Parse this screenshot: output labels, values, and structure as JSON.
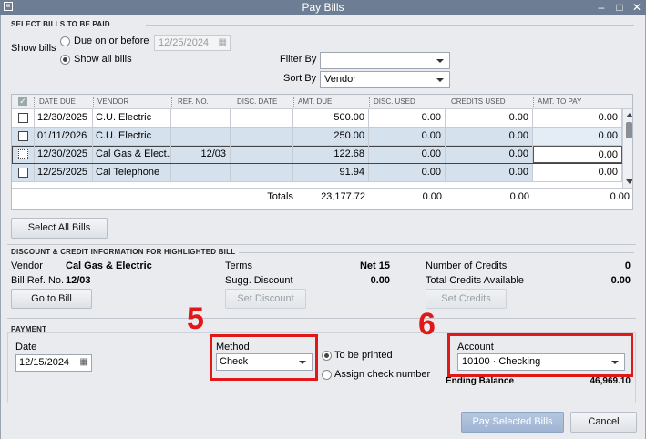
{
  "window": {
    "title": "Pay Bills"
  },
  "select_bills": {
    "section_title": "SELECT BILLS TO BE PAID",
    "show_bills_label": "Show bills",
    "due_on_or_before_label": "Due on or before",
    "due_date_value": "12/25/2024",
    "show_all_label": "Show all bills",
    "filter_by_label": "Filter By",
    "filter_by_value": "",
    "sort_by_label": "Sort By",
    "sort_by_value": "Vendor"
  },
  "table": {
    "columns": [
      "DATE DUE",
      "VENDOR",
      "REF. NO.",
      "DISC. DATE",
      "AMT. DUE",
      "DISC. USED",
      "CREDITS USED",
      "AMT. TO PAY"
    ],
    "rows": [
      {
        "date_due": "12/30/2025",
        "vendor": "C.U. Electric",
        "ref_no": "",
        "disc_date": "",
        "amt_due": "500.00",
        "disc_used": "0.00",
        "credits_used": "0.00",
        "amt_to_pay": "0.00"
      },
      {
        "date_due": "01/11/2026",
        "vendor": "C.U. Electric",
        "ref_no": "",
        "disc_date": "",
        "amt_due": "250.00",
        "disc_used": "0.00",
        "credits_used": "0.00",
        "amt_to_pay": "0.00"
      },
      {
        "date_due": "12/30/2025",
        "vendor": "Cal Gas & Elect...",
        "ref_no": "12/03",
        "disc_date": "",
        "amt_due": "122.68",
        "disc_used": "0.00",
        "credits_used": "0.00",
        "amt_to_pay": "0.00"
      },
      {
        "date_due": "12/25/2025",
        "vendor": "Cal Telephone",
        "ref_no": "",
        "disc_date": "",
        "amt_due": "91.94",
        "disc_used": "0.00",
        "credits_used": "0.00",
        "amt_to_pay": "0.00"
      }
    ],
    "totals": {
      "label": "Totals",
      "amt_due": "23,177.72",
      "disc_used": "0.00",
      "credits_used": "0.00",
      "amt_to_pay": "0.00"
    }
  },
  "select_all_label": "Select All Bills",
  "discount": {
    "section_title": "DISCOUNT & CREDIT INFORMATION FOR HIGHLIGHTED BILL",
    "vendor_label": "Vendor",
    "vendor_value": "Cal Gas & Electric",
    "bill_ref_label": "Bill Ref. No.",
    "bill_ref_value": "12/03",
    "terms_label": "Terms",
    "terms_value": "Net 15",
    "sugg_discount_label": "Sugg. Discount",
    "sugg_discount_value": "0.00",
    "num_credits_label": "Number of Credits",
    "num_credits_value": "0",
    "total_credits_label": "Total Credits Available",
    "total_credits_value": "0.00",
    "go_to_bill_label": "Go to Bill",
    "set_discount_label": "Set Discount",
    "set_credits_label": "Set Credits"
  },
  "payment": {
    "section_title": "PAYMENT",
    "date_label": "Date",
    "date_value": "12/15/2024",
    "method_label": "Method",
    "method_value": "Check",
    "to_be_printed_label": "To be printed",
    "assign_check_label": "Assign check number",
    "account_label": "Account",
    "account_value": "10100 · Checking",
    "ending_balance_label": "Ending Balance",
    "ending_balance_value": "46,969.10"
  },
  "annotations": {
    "method_step": "5",
    "account_step": "6",
    "highlight_color": "#e01818"
  },
  "footer": {
    "pay_selected_label": "Pay Selected Bills",
    "cancel_label": "Cancel"
  }
}
